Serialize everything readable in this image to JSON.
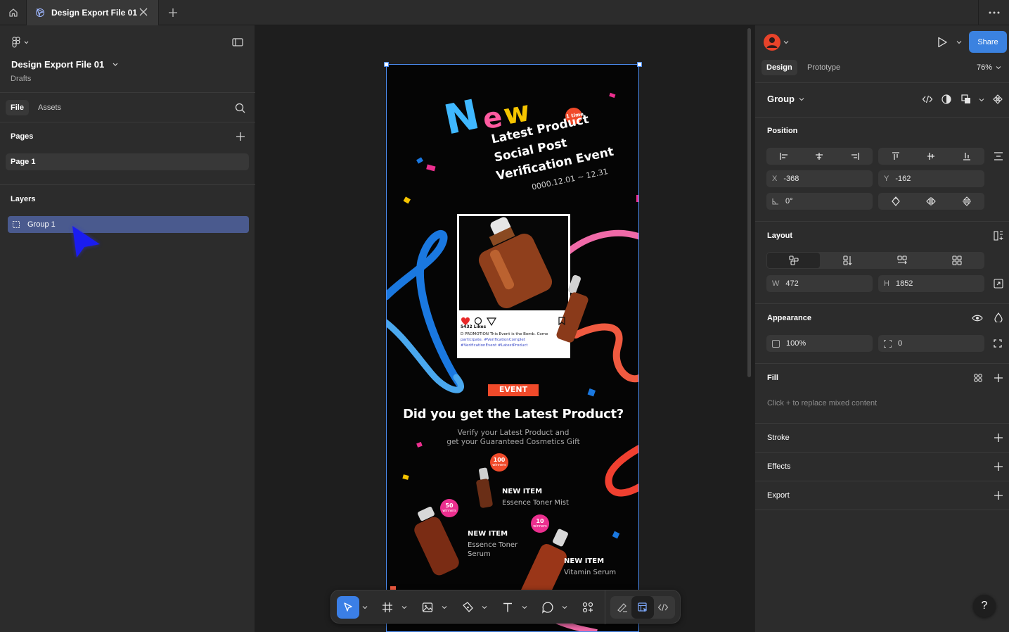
{
  "tabbar": {
    "tab_title": "Design Export File 01"
  },
  "left": {
    "file_name": "Design Export File 01",
    "location": "Drafts",
    "tabs": [
      "File",
      "Assets"
    ],
    "pages_heading": "Pages",
    "page_item": "Page 1",
    "layers_heading": "Layers",
    "layer_item": "Group 1"
  },
  "poster": {
    "headline": "New",
    "badge": "1 time",
    "line1": "Latest Product",
    "line2": "Social Post",
    "line3": "Verification Event",
    "dates": "0000.12.01 ~ 12.31",
    "likes": "5432 Likes",
    "caption_line1": "D PROMOTION This Event is the Bomb. Come",
    "caption_line2": "participate. #VerificationComplet",
    "caption_line3": "#VerificationEvent #LatestProduct",
    "event_tag": "EVENT",
    "question": "Did you get the Latest Product?",
    "sub1": "Verify your Latest Product and",
    "sub2": "get your Guaranteed Cosmetics Gift",
    "items": [
      {
        "badge_num": "100",
        "badge_sub": "winners",
        "title": "NEW ITEM",
        "name": "Essence Toner Mist"
      },
      {
        "badge_num": "50",
        "badge_sub": "winners",
        "title": "NEW ITEM",
        "name_l1": "Essence Toner",
        "name_l2": "Serum"
      },
      {
        "badge_num": "10",
        "badge_sub": "winners",
        "title": "NEW ITEM",
        "name": "Vitamin Serum"
      }
    ]
  },
  "right": {
    "share_label": "Share",
    "tabs": [
      "Design",
      "Prototype"
    ],
    "zoom": "76%",
    "selection_type": "Group",
    "position_heading": "Position",
    "x_label": "X",
    "x_value": "-368",
    "y_label": "Y",
    "y_value": "-162",
    "rotation": "0°",
    "layout_heading": "Layout",
    "w_label": "W",
    "w_value": "472",
    "h_label": "H",
    "h_value": "1852",
    "appearance_heading": "Appearance",
    "opacity": "100%",
    "radius": "0",
    "fill_heading": "Fill",
    "fill_hint": "Click + to replace mixed content",
    "stroke_heading": "Stroke",
    "effects_heading": "Effects",
    "export_heading": "Export",
    "help": "?"
  },
  "colors": {
    "accent": "#3b82e0",
    "layer_selected": "#4a5a8e",
    "event_red": "#f04a2a",
    "badge_pink": "#ec2f8f"
  }
}
